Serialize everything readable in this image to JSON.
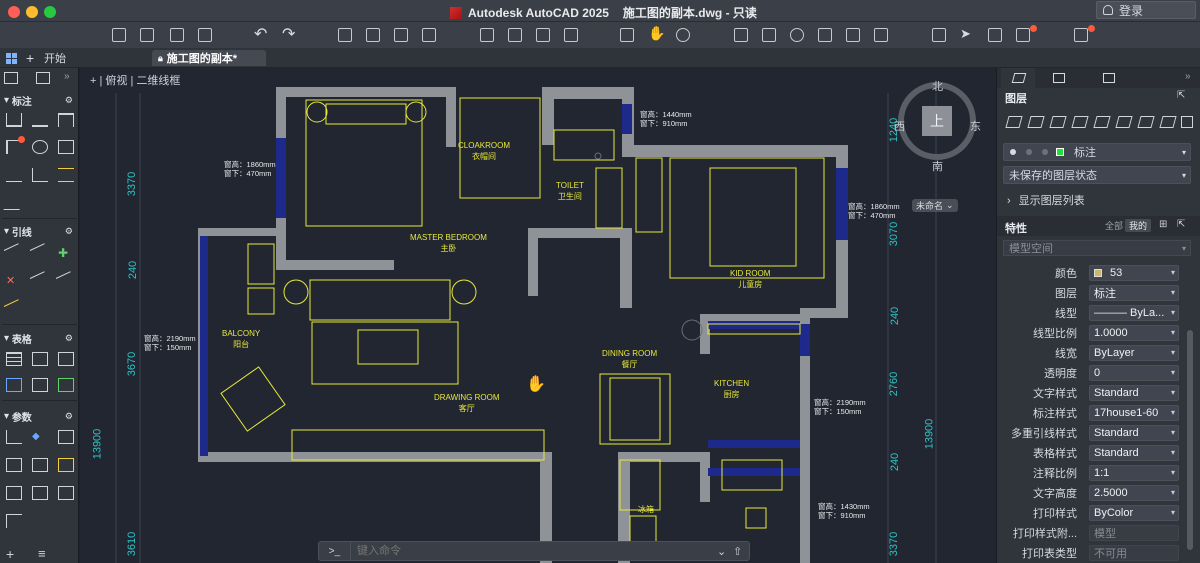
{
  "title_bar": {
    "app_title": "Autodesk AutoCAD 2025",
    "document_title": "施工图的副本.dwg - 只读",
    "login_label": "登录"
  },
  "tabs": {
    "start_label": "开始",
    "active_label": "施工图的副本*"
  },
  "viewport": {
    "label": "+ | 俯视 | 二维线框",
    "view_cube": {
      "top": "上",
      "north": "北",
      "south": "南",
      "east": "东",
      "west": "西",
      "ucs_label": "未命名"
    }
  },
  "command_bar": {
    "prompt": ">_",
    "placeholder": "键入命令"
  },
  "left_palette": {
    "sections": [
      {
        "label": "标注"
      },
      {
        "label": "引线"
      },
      {
        "label": "表格"
      },
      {
        "label": "参数"
      }
    ]
  },
  "drawing": {
    "rooms": [
      {
        "en": "MASTER BEDROOM",
        "cn": "主卧"
      },
      {
        "en": "CLOAKROOM",
        "cn": "衣帽间"
      },
      {
        "en": "TOILET",
        "cn": "卫生间"
      },
      {
        "en": "KID ROOM",
        "cn": "儿童房"
      },
      {
        "en": "BALCONY",
        "cn": "阳台"
      },
      {
        "en": "DRAWING ROOM",
        "cn": "客厅"
      },
      {
        "en": "DINING ROOM",
        "cn": "餐厅"
      },
      {
        "en": "KITCHEN",
        "cn": "厨房"
      },
      {
        "en": "",
        "cn": "冰箱"
      }
    ],
    "window_notes": [
      {
        "line1": "窗高：1440mm",
        "line2": "窗下：910mm"
      },
      {
        "line1": "窗高：1860mm",
        "line2": "窗下：470mm"
      },
      {
        "line1": "窗高：1860mm",
        "line2": "窗下：470mm"
      },
      {
        "line1": "窗高：2190mm",
        "line2": "窗下：150mm"
      },
      {
        "line1": "窗高：2190mm",
        "line2": "窗下：150mm"
      },
      {
        "line1": "窗高：1430mm",
        "line2": "窗下：910mm"
      }
    ],
    "dimensions_left": [
      "3370",
      "240",
      "3670",
      "13900",
      "3610"
    ],
    "dimensions_right": [
      "1240",
      "3070",
      "240",
      "2760",
      "240",
      "13900",
      "3370"
    ]
  },
  "right_palette": {
    "layers_heading": "图层",
    "current_layer": "标注",
    "layer_state": "未保存的图层状态",
    "show_layer_list": "显示图层列表",
    "properties_heading": "特性",
    "filter_all": "全部",
    "filter_mine": "我的",
    "model_space": "模型空间",
    "properties": [
      {
        "label": "颜色",
        "value": "53",
        "disabled": false
      },
      {
        "label": "图层",
        "value": "标注",
        "disabled": false
      },
      {
        "label": "线型",
        "value": "——— ByLa...",
        "disabled": false
      },
      {
        "label": "线型比例",
        "value": "1.0000",
        "disabled": false
      },
      {
        "label": "线宽",
        "value": "ByLayer",
        "disabled": false
      },
      {
        "label": "透明度",
        "value": "0",
        "disabled": false
      },
      {
        "label": "文字样式",
        "value": "Standard",
        "disabled": false
      },
      {
        "label": "标注样式",
        "value": "17house1-60",
        "disabled": false
      },
      {
        "label": "多重引线样式",
        "value": "Standard",
        "disabled": false
      },
      {
        "label": "表格样式",
        "value": "Standard",
        "disabled": false
      },
      {
        "label": "注释比例",
        "value": "1:1",
        "disabled": false
      },
      {
        "label": "文字高度",
        "value": "2.5000",
        "disabled": false
      },
      {
        "label": "打印样式",
        "value": "ByColor",
        "disabled": false
      },
      {
        "label": "打印样式附...",
        "value": "模型",
        "disabled": true
      },
      {
        "label": "打印表类型",
        "value": "不可用",
        "disabled": true
      }
    ]
  },
  "colors": {
    "wall": "#8f9296",
    "furniture": "#e8e83a",
    "window": "#1d2a8c",
    "dimension": "#2ec4c4",
    "background": "#212631"
  }
}
